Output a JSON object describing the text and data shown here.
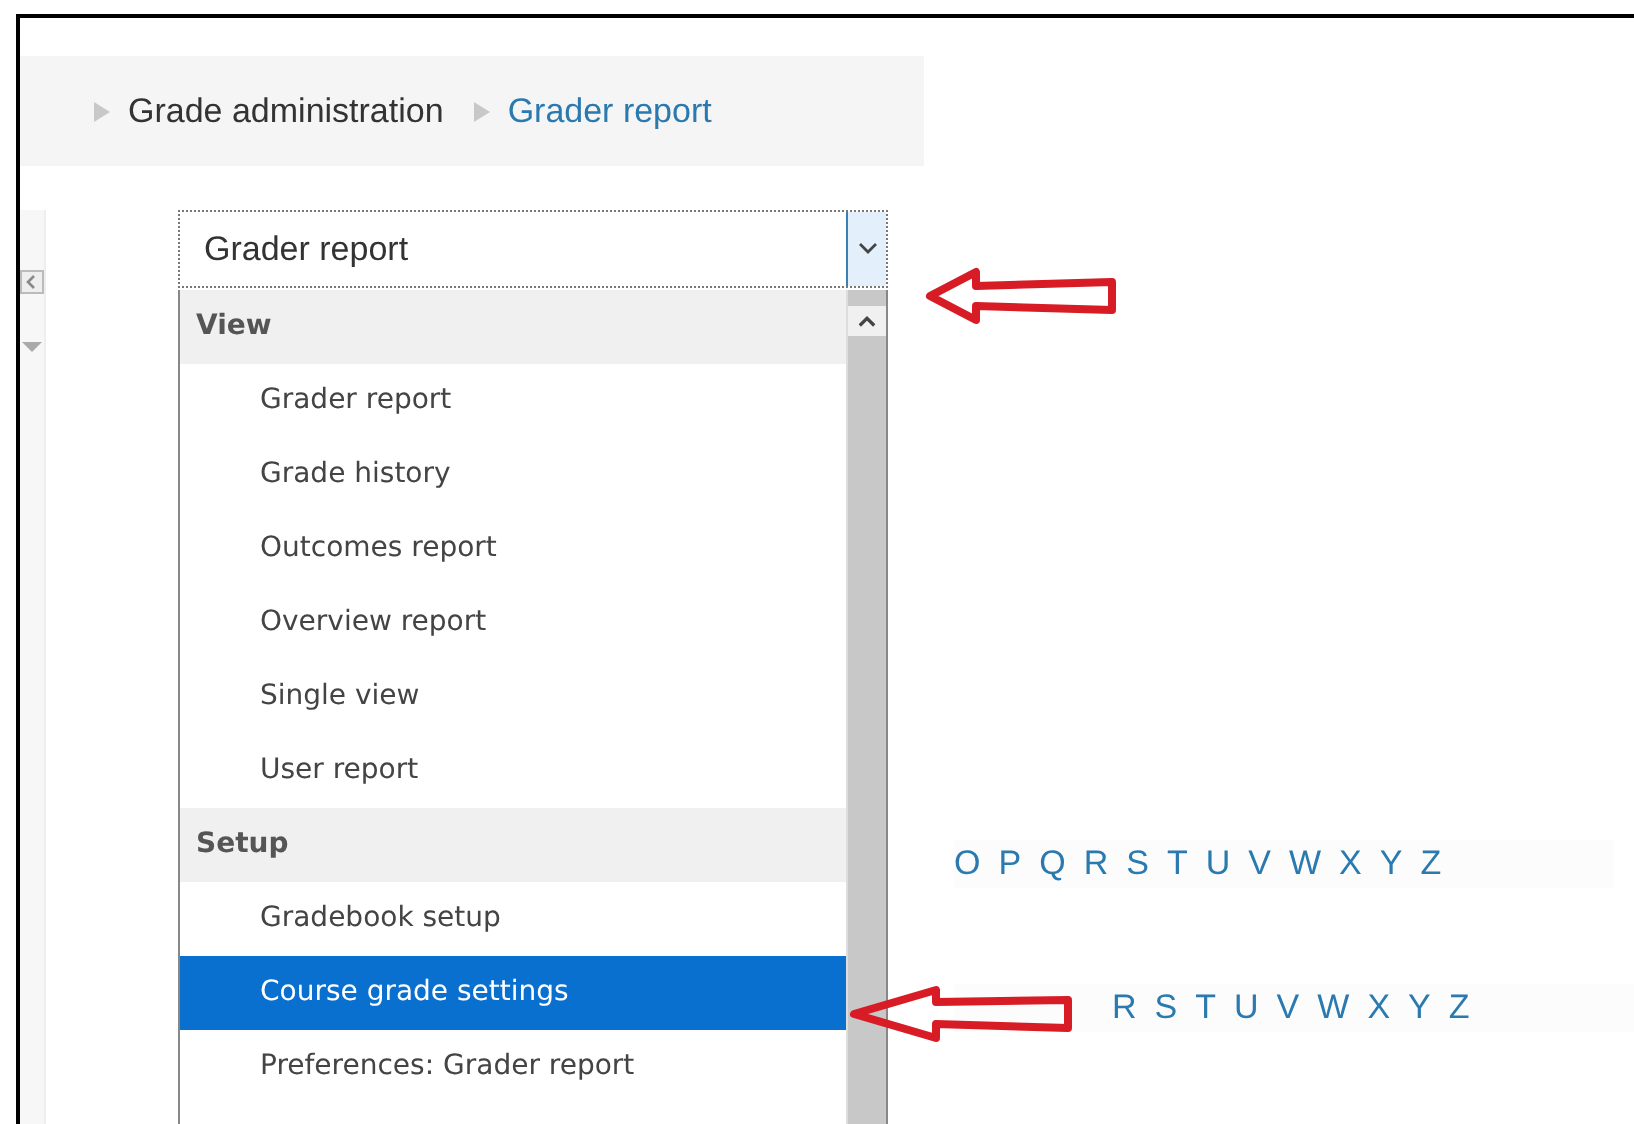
{
  "breadcrumb": [
    {
      "label": "Grade administration",
      "current": false
    },
    {
      "label": "Grader report",
      "current": true
    }
  ],
  "report_select": {
    "value": "Grader report"
  },
  "dropdown": {
    "groups": [
      {
        "label": "View",
        "items": [
          {
            "label": "Grader report",
            "selected": false
          },
          {
            "label": "Grade history",
            "selected": false
          },
          {
            "label": "Outcomes report",
            "selected": false
          },
          {
            "label": "Overview report",
            "selected": false
          },
          {
            "label": "Single view",
            "selected": false
          },
          {
            "label": "User report",
            "selected": false
          }
        ]
      },
      {
        "label": "Setup",
        "items": [
          {
            "label": "Gradebook setup",
            "selected": false
          },
          {
            "label": "Course grade settings",
            "selected": true
          },
          {
            "label": "Preferences: Grader report",
            "selected": false
          }
        ]
      }
    ]
  },
  "initial_filters": [
    {
      "letters": [
        "O",
        "P",
        "Q",
        "R",
        "S",
        "T",
        "U",
        "V",
        "W",
        "X",
        "Y",
        "Z"
      ]
    },
    {
      "letters": [
        "R",
        "S",
        "T",
        "U",
        "V",
        "W",
        "X",
        "Y",
        "Z"
      ]
    }
  ]
}
